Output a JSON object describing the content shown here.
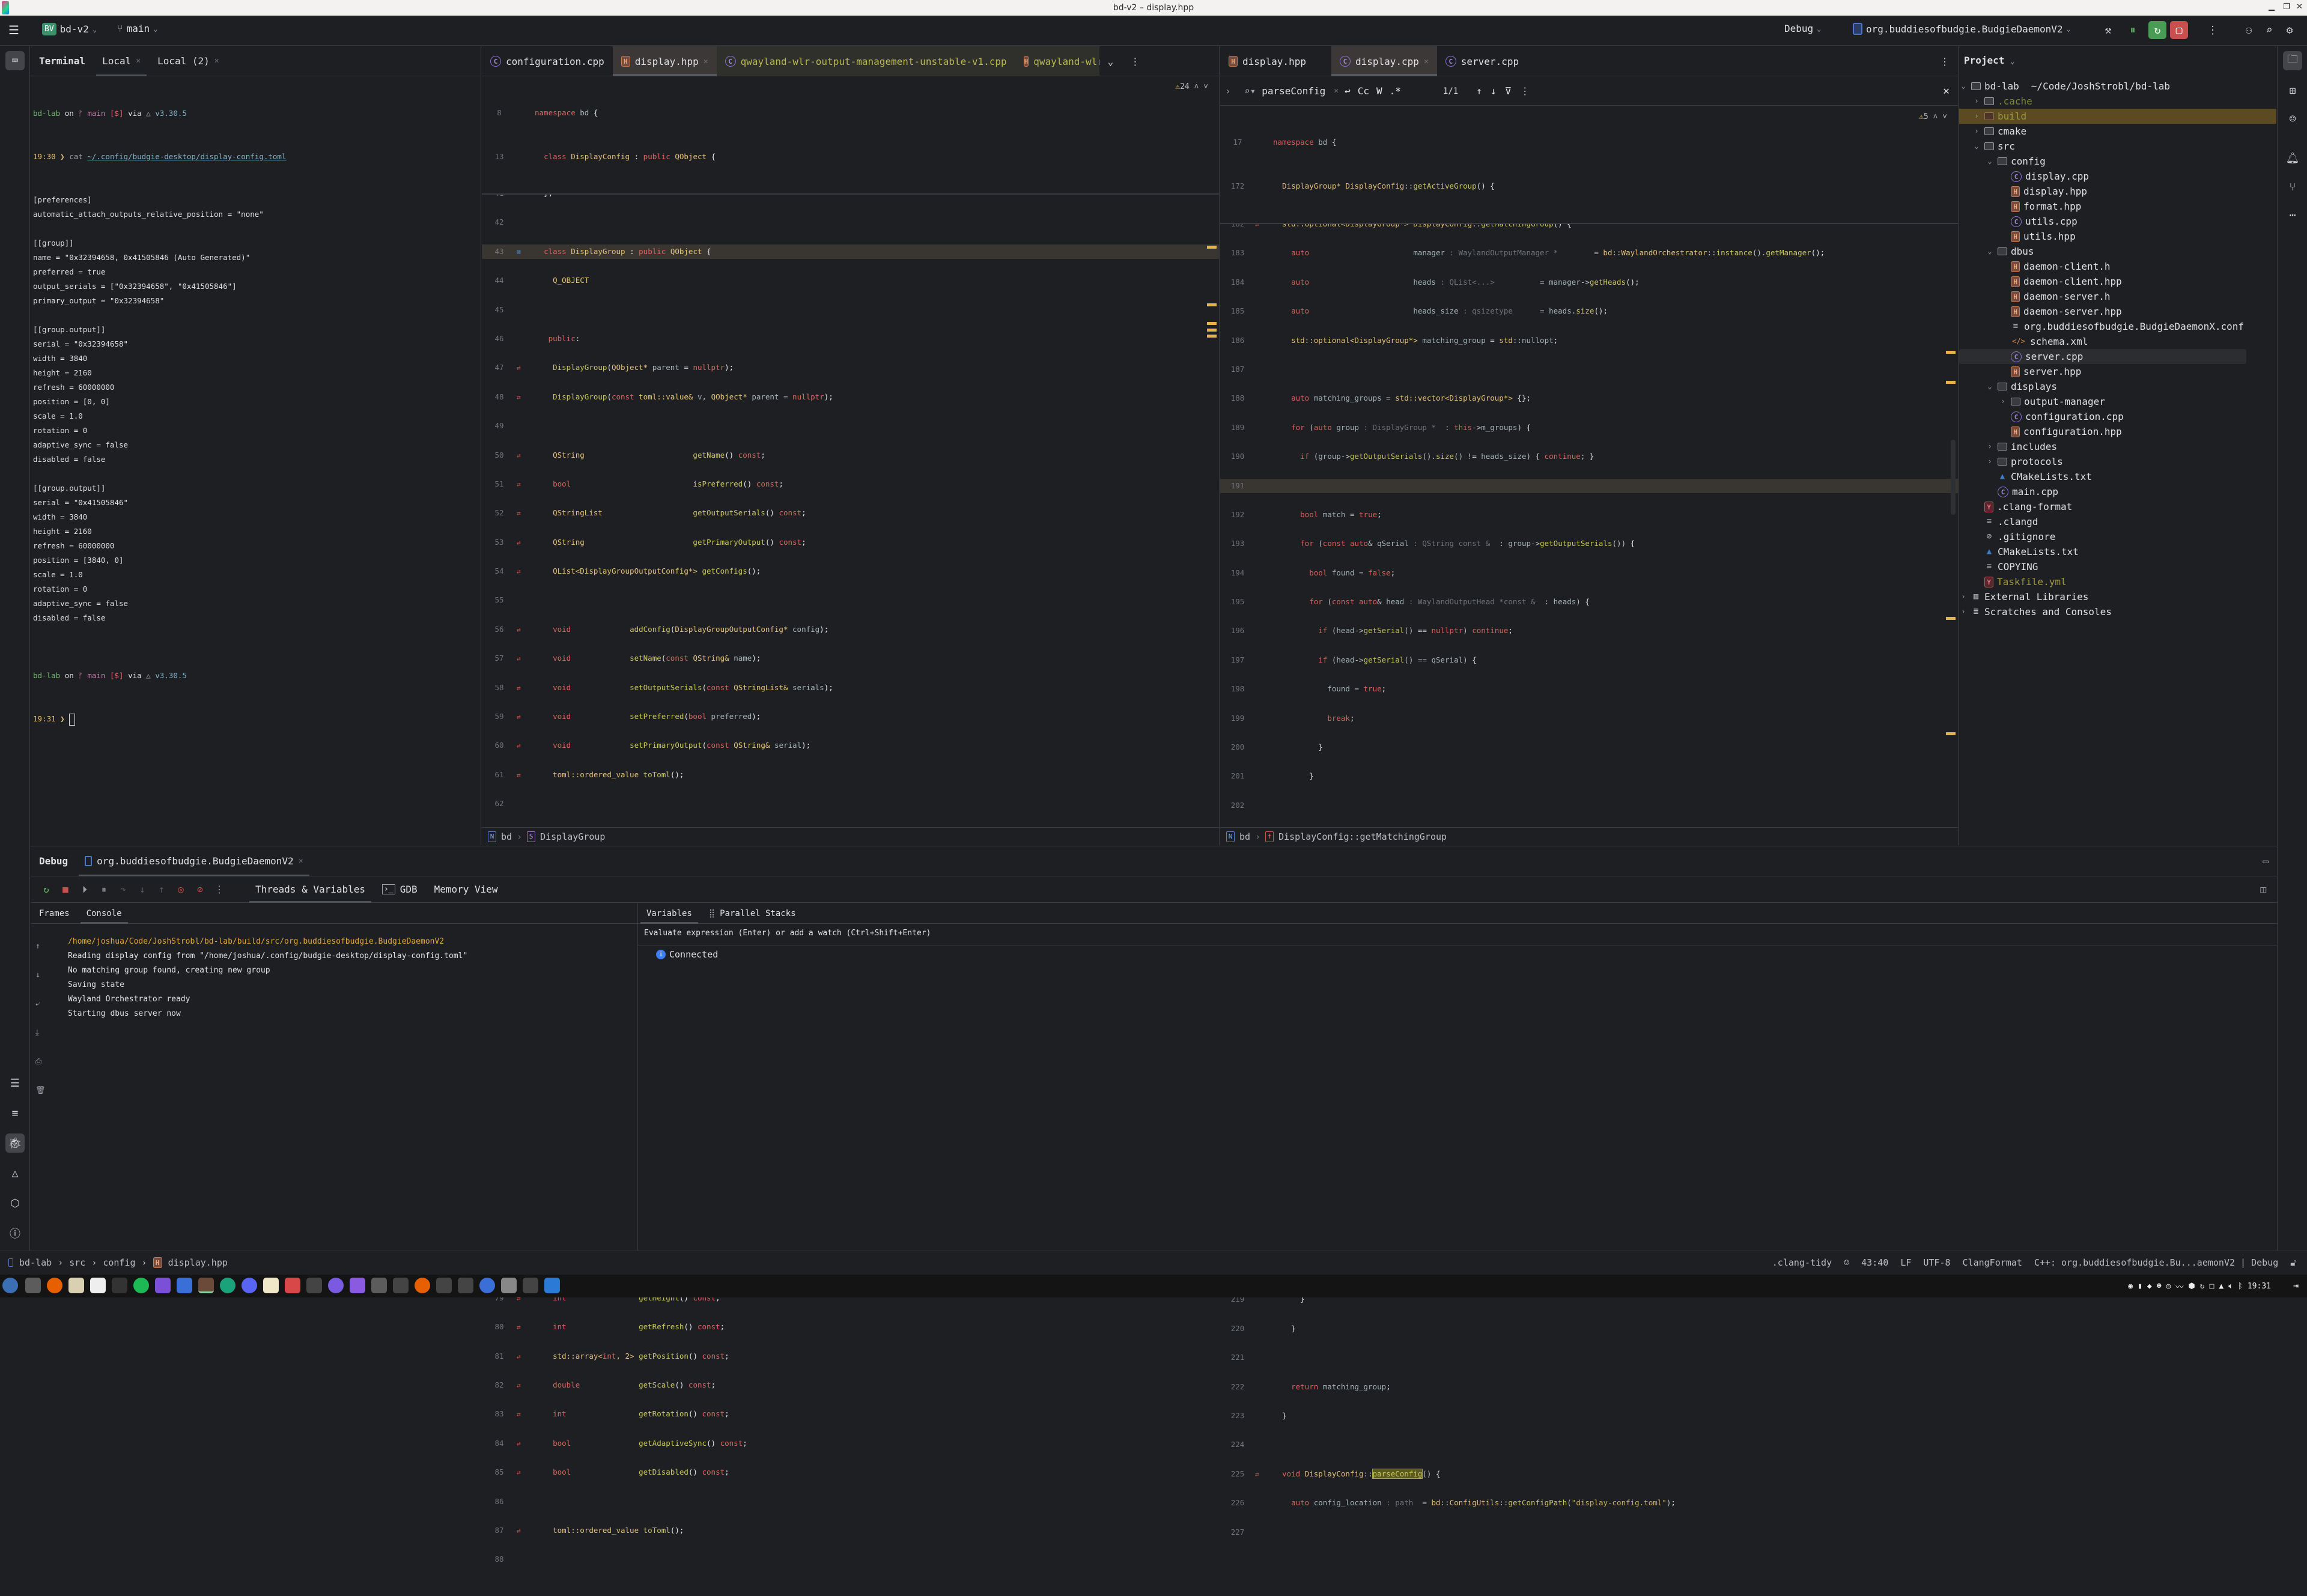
{
  "window": {
    "title": "bd-v2 – display.hpp",
    "controls": [
      "minimize",
      "maximize",
      "close"
    ]
  },
  "toolbar": {
    "project_badge": "BV",
    "project_name": "bd-v2",
    "branch": "main",
    "build_config": "Debug",
    "run_target": "org.buddiesofbudgie.BudgieDaemonV2"
  },
  "terminal": {
    "header": "Terminal",
    "tabs": [
      {
        "label": "Local"
      },
      {
        "label": "Local (2)"
      }
    ],
    "prompt1": {
      "dir": "bd-lab",
      "on": "on",
      "branch": "main",
      "status": "[$]",
      "via": "via",
      "tool": "v3.30.5",
      "time": "19:30",
      "cmd": "cat",
      "arg": "~/.config/budgie-desktop/display-config.toml"
    },
    "output": [
      "[preferences]",
      "automatic_attach_outputs_relative_position = \"none\"",
      "",
      "[[group]]",
      "name = \"0x32394658, 0x41505846 (Auto Generated)\"",
      "preferred = true",
      "output_serials = [\"0x32394658\", \"0x41505846\"]",
      "primary_output = \"0x32394658\"",
      "",
      "[[group.output]]",
      "serial = \"0x32394658\"",
      "width = 3840",
      "height = 2160",
      "refresh = 60000000",
      "position = [0, 0]",
      "scale = 1.0",
      "rotation = 0",
      "adaptive_sync = false",
      "disabled = false",
      "",
      "[[group.output]]",
      "serial = \"0x41505846\"",
      "width = 3840",
      "height = 2160",
      "refresh = 60000000",
      "position = [3840, 0]",
      "scale = 1.0",
      "rotation = 0",
      "adaptive_sync = false",
      "disabled = false",
      ""
    ],
    "prompt2": {
      "dir": "bd-lab",
      "on": "on",
      "branch": "main",
      "status": "[$]",
      "via": "via",
      "tool": "v3.30.5",
      "time": "19:31"
    }
  },
  "left_editor": {
    "tabs": [
      {
        "label": "configuration.cpp",
        "type": "cpp"
      },
      {
        "label": "display.hpp",
        "type": "hpp",
        "selected": true
      },
      {
        "label": "qwayland-wlr-output-management-unstable-v1.cpp",
        "type": "cpp"
      },
      {
        "label": "qwayland-wlr",
        "type": "hpp"
      }
    ],
    "warnings": "24",
    "sticky": [
      {
        "ln": "8",
        "code": "namespace bd {"
      },
      {
        "ln": "13",
        "code": "class DisplayConfig : public QObject {"
      }
    ],
    "breadcrumb": [
      "bd",
      "DisplayGroup"
    ]
  },
  "right_editor": {
    "tabs": [
      {
        "label": "display.hpp",
        "type": "hpp"
      },
      {
        "label": "display.cpp",
        "type": "cpp",
        "selected": true
      },
      {
        "label": "server.cpp",
        "type": "cpp"
      }
    ],
    "find": {
      "query": "parseConfig",
      "count": "1/1",
      "opts": [
        "Cc",
        "W",
        ".*"
      ]
    },
    "warnings": "5",
    "sticky": [
      {
        "ln": "17",
        "code": "namespace bd {"
      },
      {
        "ln": "172",
        "code": "DisplayGroup* DisplayConfig::getActiveGroup() {"
      }
    ],
    "breadcrumb": [
      "bd",
      "DisplayConfig::getMatchingGroup"
    ]
  },
  "project": {
    "title": "Project",
    "root": {
      "name": "bd-lab",
      "path": "~/Code/JoshStrobl/bd-lab"
    },
    "items": [
      {
        "name": ".cache",
        "kind": "folder",
        "depth": 1,
        "arrow": "right",
        "style": "ignored"
      },
      {
        "name": "build",
        "kind": "folder",
        "depth": 1,
        "arrow": "right",
        "style": "excluded",
        "selected": true
      },
      {
        "name": "cmake",
        "kind": "folder",
        "depth": 1,
        "arrow": "right"
      },
      {
        "name": "src",
        "kind": "folder",
        "depth": 1,
        "arrow": "down"
      },
      {
        "name": "config",
        "kind": "folder",
        "depth": 2,
        "arrow": "down"
      },
      {
        "name": "display.cpp",
        "kind": "cpp",
        "depth": 3
      },
      {
        "name": "display.hpp",
        "kind": "hpp",
        "depth": 3
      },
      {
        "name": "format.hpp",
        "kind": "hpp",
        "depth": 3
      },
      {
        "name": "utils.cpp",
        "kind": "cpp",
        "depth": 3
      },
      {
        "name": "utils.hpp",
        "kind": "hpp",
        "depth": 3
      },
      {
        "name": "dbus",
        "kind": "folder",
        "depth": 2,
        "arrow": "down"
      },
      {
        "name": "daemon-client.h",
        "kind": "hpp",
        "depth": 3
      },
      {
        "name": "daemon-client.hpp",
        "kind": "hpp",
        "depth": 3
      },
      {
        "name": "daemon-server.h",
        "kind": "hpp",
        "depth": 3
      },
      {
        "name": "daemon-server.hpp",
        "kind": "hpp",
        "depth": 3
      },
      {
        "name": "org.buddiesofbudgie.BudgieDaemonX.conf",
        "kind": "text",
        "depth": 3
      },
      {
        "name": "schema.xml",
        "kind": "xml",
        "depth": 3
      },
      {
        "name": "server.cpp",
        "kind": "cpp",
        "depth": 3,
        "hover": true
      },
      {
        "name": "server.hpp",
        "kind": "hpp",
        "depth": 3
      },
      {
        "name": "displays",
        "kind": "folder",
        "depth": 2,
        "arrow": "down"
      },
      {
        "name": "output-manager",
        "kind": "folder",
        "depth": 3,
        "arrow": "right"
      },
      {
        "name": "configuration.cpp",
        "kind": "cpp",
        "depth": 3
      },
      {
        "name": "configuration.hpp",
        "kind": "hpp",
        "depth": 3
      },
      {
        "name": "includes",
        "kind": "folder",
        "depth": 2,
        "arrow": "right"
      },
      {
        "name": "protocols",
        "kind": "folder",
        "depth": 2,
        "arrow": "right"
      },
      {
        "name": "CMakeLists.txt",
        "kind": "cmake",
        "depth": 2
      },
      {
        "name": "main.cpp",
        "kind": "cpp",
        "depth": 2
      },
      {
        "name": ".clang-format",
        "kind": "yaml",
        "depth": 1
      },
      {
        "name": ".clangd",
        "kind": "text",
        "depth": 1
      },
      {
        "name": ".gitignore",
        "kind": "ignore",
        "depth": 1
      },
      {
        "name": "CMakeLists.txt",
        "kind": "cmake",
        "depth": 1
      },
      {
        "name": "COPYING",
        "kind": "text",
        "depth": 1
      },
      {
        "name": "Taskfile.yml",
        "kind": "yaml",
        "depth": 1,
        "style": "modified"
      },
      {
        "name": "External Libraries",
        "kind": "lib",
        "depth": 0,
        "arrow": "right"
      },
      {
        "name": "Scratches and Consoles",
        "kind": "scratch",
        "depth": 0,
        "arrow": "right"
      }
    ]
  },
  "debug": {
    "header": "Debug",
    "session_tab": "org.buddiesofbudgie.BudgieDaemonV2",
    "tool_tabs": [
      "Threads & Variables",
      "GDB",
      "Memory View"
    ],
    "sub_tabs": [
      "Frames",
      "Console"
    ],
    "console_lines": [
      "/home/joshua/Code/JoshStrobl/bd-lab/build/src/org.buddiesofbudgie.BudgieDaemonV2",
      "Reading display config from \"/home/joshua/.config/budgie-desktop/display-config.toml\"",
      "No matching group found, creating new group",
      "Saving state",
      "Wayland Orchestrator ready",
      "Starting dbus server now"
    ],
    "var_tabs": [
      "Variables",
      "Parallel Stacks"
    ],
    "eval_placeholder": "Evaluate expression (Enter) or add a watch (Ctrl+Shift+Enter)",
    "status": "Connected"
  },
  "statusbar": {
    "path": [
      "bd-lab",
      "src",
      "config",
      "display.hpp"
    ],
    "inspection": ".clang-tidy",
    "position": "43:40",
    "line_sep": "LF",
    "encoding": "UTF-8",
    "formatter": "ClangFormat",
    "context": "C++: org.buddiesofbudgie.Bu...aemonV2 | Debug"
  },
  "taskbar": {
    "clock": "19:31"
  }
}
